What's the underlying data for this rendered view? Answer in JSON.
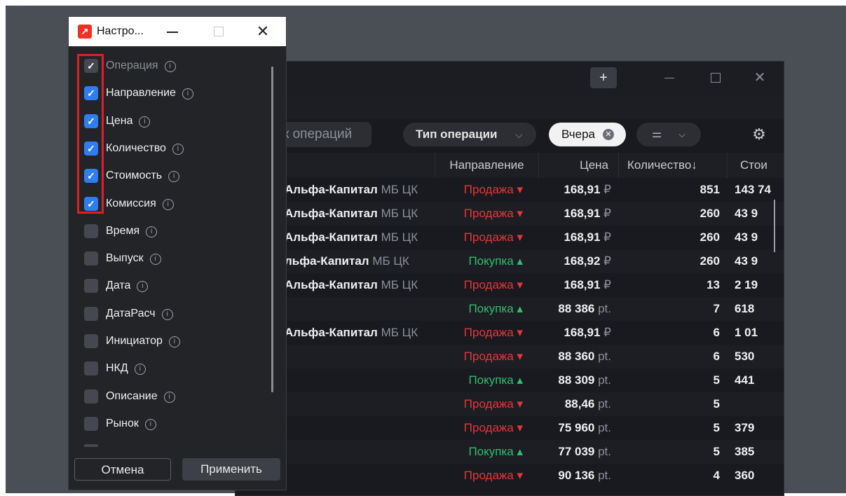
{
  "dialog": {
    "title": "Настро...",
    "options": [
      {
        "label": "Операция",
        "checked": true,
        "disabled": true
      },
      {
        "label": "Направление",
        "checked": true
      },
      {
        "label": "Цена",
        "checked": true
      },
      {
        "label": "Количество",
        "checked": true
      },
      {
        "label": "Стоимость",
        "checked": true
      },
      {
        "label": "Комиссия",
        "checked": true
      },
      {
        "label": "Время",
        "checked": false
      },
      {
        "label": "Выпуск",
        "checked": false
      },
      {
        "label": "Дата",
        "checked": false
      },
      {
        "label": "ДатаРасч",
        "checked": false
      },
      {
        "label": "Инициатор",
        "checked": false
      },
      {
        "label": "НКД",
        "checked": false
      },
      {
        "label": "Описание",
        "checked": false
      },
      {
        "label": "Рынок",
        "checked": false
      }
    ],
    "cancel_label": "Отмена",
    "apply_label": "Применить"
  },
  "main_window": {
    "new_tab_label": "+",
    "filters": {
      "search_placeholder": "к операций",
      "operation_type_label": "Тип операции",
      "date_chip_label": "Вчера"
    },
    "columns": {
      "direction": "Направление",
      "price": "Цена",
      "quantity": "Количество",
      "quantity_sort": "↓",
      "cost": "Стои"
    },
    "rows": [
      {
        "instrument": "Альфа-Капитал",
        "market": "МБ ЦК",
        "direction": "Продажа",
        "dir_type": "sell",
        "price": "168,91",
        "unit": "₽",
        "quantity": "851",
        "cost": "143 74"
      },
      {
        "instrument": "Альфа-Капитал",
        "market": "МБ ЦК",
        "direction": "Продажа",
        "dir_type": "sell",
        "price": "168,91",
        "unit": "₽",
        "quantity": "260",
        "cost": "43 9"
      },
      {
        "instrument": "Альфа-Капитал",
        "market": "МБ ЦК",
        "direction": "Продажа",
        "dir_type": "sell",
        "price": "168,91",
        "unit": "₽",
        "quantity": "260",
        "cost": "43 9"
      },
      {
        "instrument": "льфа-Капитал",
        "market": "МБ ЦК",
        "direction": "Покупка",
        "dir_type": "buy",
        "price": "168,92",
        "unit": "₽",
        "quantity": "260",
        "cost": "43 9"
      },
      {
        "instrument": "Альфа-Капитал",
        "market": "МБ ЦК",
        "direction": "Продажа",
        "dir_type": "sell",
        "price": "168,91",
        "unit": "₽",
        "quantity": "13",
        "cost": "2 19"
      },
      {
        "instrument": "",
        "market": "",
        "direction": "Покупка",
        "dir_type": "buy",
        "price": "88 386",
        "unit": "pt.",
        "quantity": "7",
        "cost": "618"
      },
      {
        "instrument": "Альфа-Капитал",
        "market": "МБ ЦК",
        "direction": "Продажа",
        "dir_type": "sell",
        "price": "168,91",
        "unit": "₽",
        "quantity": "6",
        "cost": "1 01"
      },
      {
        "instrument": "",
        "market": "",
        "direction": "Продажа",
        "dir_type": "sell",
        "price": "88 360",
        "unit": "pt.",
        "quantity": "6",
        "cost": "530"
      },
      {
        "instrument": "",
        "market": "",
        "direction": "Покупка",
        "dir_type": "buy",
        "price": "88 309",
        "unit": "pt.",
        "quantity": "5",
        "cost": "441"
      },
      {
        "instrument": "",
        "market": "",
        "direction": "Продажа",
        "dir_type": "sell",
        "price": "88,46",
        "unit": "pt.",
        "quantity": "5",
        "cost": ""
      },
      {
        "instrument": "",
        "market": "",
        "direction": "Продажа",
        "dir_type": "sell",
        "price": "75 960",
        "unit": "pt.",
        "quantity": "5",
        "cost": "379"
      },
      {
        "instrument": "",
        "market": "",
        "direction": "Покупка",
        "dir_type": "buy",
        "price": "77 039",
        "unit": "pt.",
        "quantity": "5",
        "cost": "385"
      },
      {
        "instrument": "",
        "market": "",
        "direction": "Продажа",
        "dir_type": "sell",
        "price": "90 136",
        "unit": "pt.",
        "quantity": "4",
        "cost": "360"
      }
    ]
  },
  "colors": {
    "sell": "#e8353a",
    "buy": "#2fbf71",
    "checkbox_checked": "#2e7ef0",
    "highlight": "#e02020"
  }
}
